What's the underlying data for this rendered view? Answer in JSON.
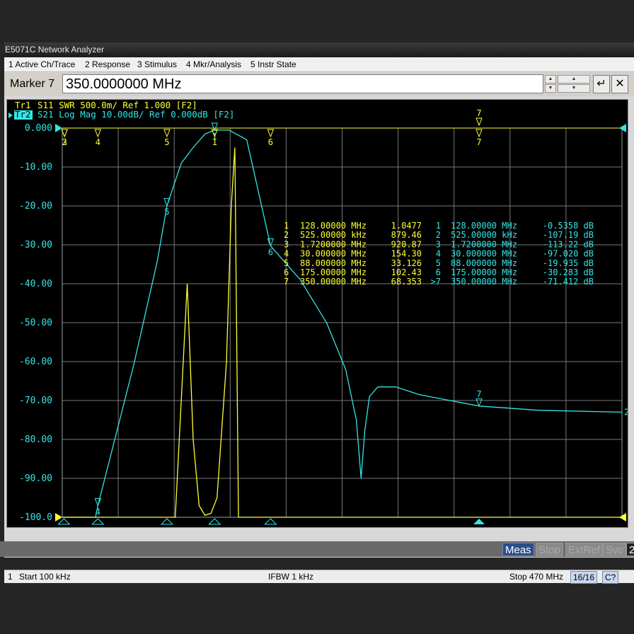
{
  "window_title": "E5071C Network Analyzer",
  "menu": [
    {
      "label": "1 Active Ch/Trace"
    },
    {
      "label": "2 Response"
    },
    {
      "label": "3 Stimulus"
    },
    {
      "label": "4 Mkr/Analysis"
    },
    {
      "label": "5 Instr State"
    }
  ],
  "entry": {
    "label": "Marker 7",
    "value": "350.0000000 MHz"
  },
  "traces": {
    "tr1": {
      "label": "Tr1",
      "text": "S11  SWR 500.0m/ Ref 1.000 [F2]",
      "color": "#ffff33"
    },
    "tr2": {
      "label": "Tr2",
      "text": "S21 Log Mag 10.00dB/ Ref 0.000dB [F2]",
      "color": "#33e6e6"
    }
  },
  "y_ticks": [
    "0.000",
    "-10.00",
    "-20.00",
    "-30.00",
    "-40.00",
    "-50.00",
    "-60.00",
    "-70.00",
    "-80.00",
    "-90.00",
    "-100.0"
  ],
  "marker_table_tr1": [
    {
      "n": "1",
      "freq": "128.00000 MHz",
      "val": "1.0477"
    },
    {
      "n": "2",
      "freq": "525.00000 kHz",
      "val": "879.46"
    },
    {
      "n": "3",
      "freq": "1.7200000 MHz",
      "val": "920.87"
    },
    {
      "n": "4",
      "freq": "30.000000 MHz",
      "val": "154.30"
    },
    {
      "n": "5",
      "freq": "88.000000 MHz",
      "val": "33.126"
    },
    {
      "n": "6",
      "freq": "175.00000 MHz",
      "val": "102.43"
    },
    {
      "n": "7",
      "freq": "350.00000 MHz",
      "val": "68.353"
    }
  ],
  "marker_table_tr2": [
    {
      "n": "1",
      "freq": "128.00000 MHz",
      "val": "-0.5358 dB"
    },
    {
      "n": "2",
      "freq": "525.00000 kHz",
      "val": "-107.19 dB"
    },
    {
      "n": "3",
      "freq": "1.7200000 MHz",
      "val": "-113.22 dB"
    },
    {
      "n": "4",
      "freq": "30.000000 MHz",
      "val": "-97.020 dB"
    },
    {
      "n": "5",
      "freq": "88.000000 MHz",
      "val": "-19.935 dB"
    },
    {
      "n": "6",
      "freq": "175.00000 MHz",
      "val": "-30.283 dB"
    },
    {
      "n": "7",
      "freq": "350.00000 MHz",
      "val": "-71.412 dB",
      "active": ">7"
    }
  ],
  "status": {
    "channel": "1",
    "start": "Start 100 kHz",
    "ifbw": "IFBW 1 kHz",
    "stop": "Stop 470 MHz",
    "trace_count": "16/16",
    "cal": "C?"
  },
  "bottom_buttons": [
    "Meas",
    "Stop",
    "ExtRef",
    "Svc",
    "2"
  ],
  "chart_data": {
    "type": "line",
    "x_range_mhz": [
      0.1,
      470
    ],
    "grid": true,
    "series": [
      {
        "name": "S21 Log Mag",
        "unit": "dB",
        "color": "#33e6e6",
        "points_mhz_db": [
          [
            0.1,
            -100
          ],
          [
            20,
            -100
          ],
          [
            28,
            -100
          ],
          [
            30,
            -97.02
          ],
          [
            40,
            -85
          ],
          [
            60,
            -61
          ],
          [
            80,
            -34
          ],
          [
            88,
            -19.935
          ],
          [
            100,
            -9
          ],
          [
            110,
            -5
          ],
          [
            120,
            -1.5
          ],
          [
            128,
            -0.5358
          ],
          [
            140,
            -0.5
          ],
          [
            155,
            -3
          ],
          [
            175,
            -30.283
          ],
          [
            200,
            -39
          ],
          [
            222,
            -50
          ],
          [
            238,
            -62
          ],
          [
            247,
            -75
          ],
          [
            251,
            -90
          ],
          [
            254,
            -78
          ],
          [
            258,
            -69
          ],
          [
            265,
            -66.5
          ],
          [
            280,
            -66.5
          ],
          [
            300,
            -68.5
          ],
          [
            350,
            -71.412
          ],
          [
            400,
            -72.5
          ],
          [
            470,
            -73
          ]
        ],
        "markers": [
          {
            "n": "1",
            "x": 128,
            "y": -0.5358
          },
          {
            "n": "2",
            "x": 0.525,
            "y": -107.19
          },
          {
            "n": "3",
            "x": 1.72,
            "y": -113.22
          },
          {
            "n": "4",
            "x": 30,
            "y": -97.02
          },
          {
            "n": "5",
            "x": 88,
            "y": -19.935
          },
          {
            "n": "6",
            "x": 175,
            "y": -30.283
          },
          {
            "n": "7",
            "x": 350,
            "y": -71.412
          }
        ]
      },
      {
        "name": "S11 SWR",
        "unit": "SWR",
        "color": "#ffff33",
        "points_mhz_db": [
          [
            0.1,
            -100
          ],
          [
            95,
            -100
          ],
          [
            105,
            -40
          ],
          [
            110,
            -80
          ],
          [
            115,
            -97
          ],
          [
            120,
            -99.5
          ],
          [
            125,
            -99
          ],
          [
            130,
            -95
          ],
          [
            138,
            -60
          ],
          [
            142,
            -20
          ],
          [
            145,
            -5
          ],
          [
            148,
            -100
          ],
          [
            470,
            -100
          ]
        ],
        "markers": [
          {
            "n": "1",
            "x": 128,
            "y": 1.0477
          },
          {
            "n": "2",
            "x": 0.525,
            "y": 879.46
          },
          {
            "n": "3",
            "x": 1.72,
            "y": 920.87
          },
          {
            "n": "4",
            "x": 30,
            "y": 154.3
          },
          {
            "n": "5",
            "x": 88,
            "y": 33.126
          },
          {
            "n": "6",
            "x": 175,
            "y": 102.43
          },
          {
            "n": "7",
            "x": 350,
            "y": 68.353
          }
        ]
      }
    ]
  }
}
